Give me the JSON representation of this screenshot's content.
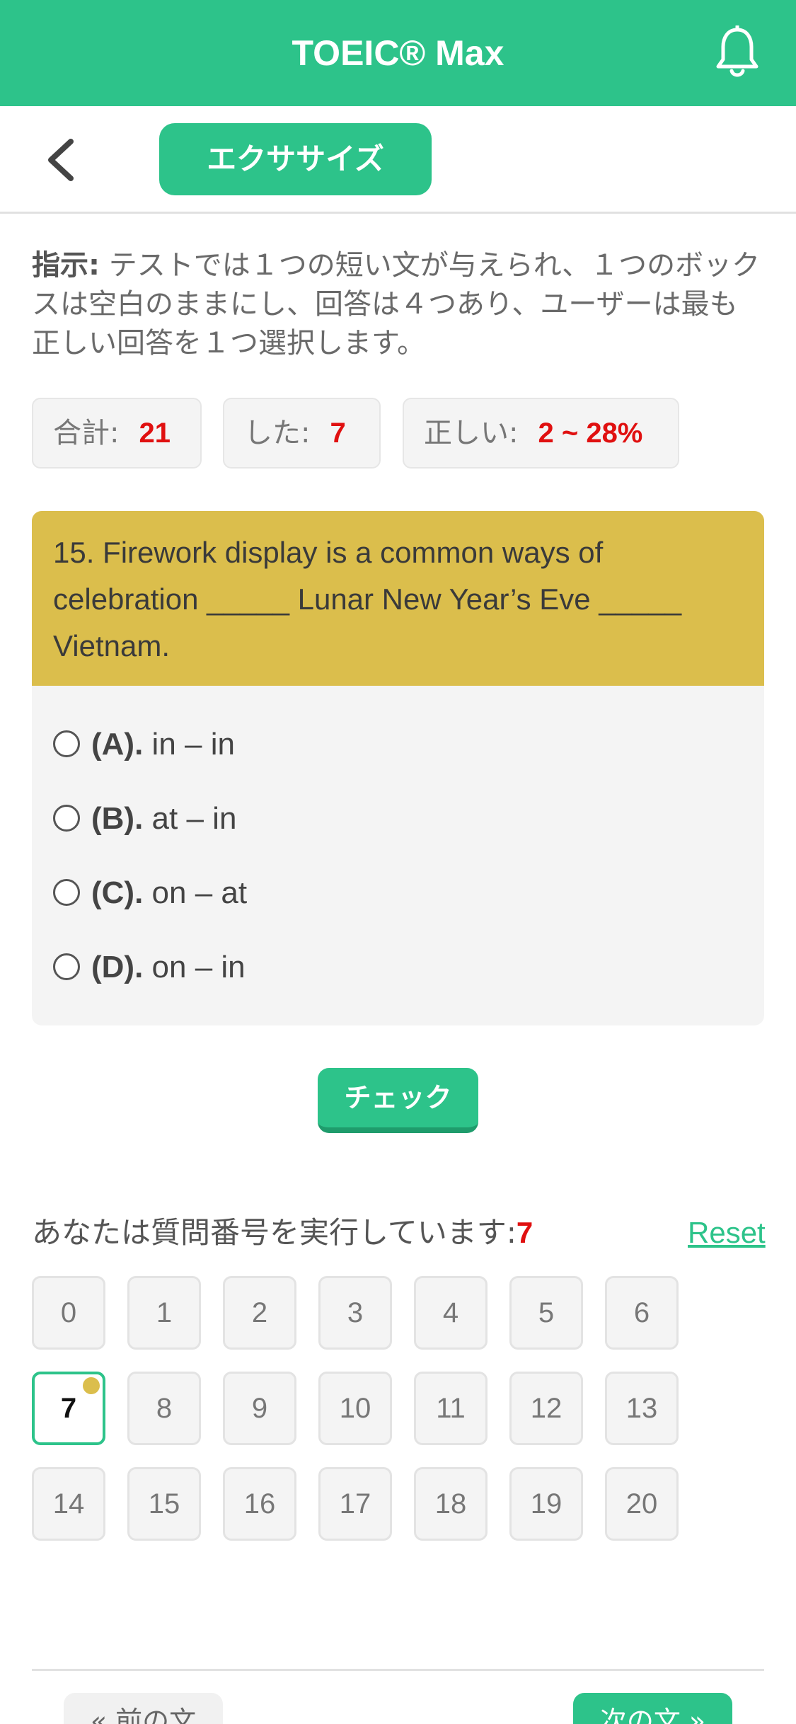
{
  "header": {
    "title": "TOEIC® Max"
  },
  "subbar": {
    "tab_label": "エクササイズ"
  },
  "instructions": {
    "label": "指示:",
    "text": "テストでは１つの短い文が与えられ、１つのボックスは空白のままにし、回答は４つあり、ユーザーは最も正しい回答を１つ選択します。"
  },
  "stats": {
    "total_label": "合計:",
    "total_value": "21",
    "done_label": "した:",
    "done_value": "7",
    "correct_label": "正しい:",
    "correct_value": "2 ~ 28%"
  },
  "question": {
    "text": "15. Firework display is a common ways of celebration _____ Lunar New Year’s Eve _____ Vietnam.",
    "options": [
      {
        "letter": "(A).",
        "text": "in – in"
      },
      {
        "letter": "(B).",
        "text": "at – in"
      },
      {
        "letter": "(C).",
        "text": "on – at"
      },
      {
        "letter": "(D).",
        "text": "on – in"
      }
    ]
  },
  "check_button": "チェック",
  "progress": {
    "label": "あなたは質問番号を実行しています:",
    "current": "7",
    "reset_label": "Reset",
    "numbers": [
      "0",
      "1",
      "2",
      "3",
      "4",
      "5",
      "6",
      "7",
      "8",
      "9",
      "10",
      "11",
      "12",
      "13",
      "14",
      "15",
      "16",
      "17",
      "18",
      "19",
      "20"
    ]
  },
  "footer": {
    "prev_label": "« 前の文",
    "next_label": "次の文 »"
  },
  "colors": {
    "accent": "#2dc38a",
    "question_bg": "#dbbe4c",
    "value_red": "#e01010"
  },
  "icons": {
    "bell": "bell-icon",
    "back": "chevron-left-icon"
  }
}
